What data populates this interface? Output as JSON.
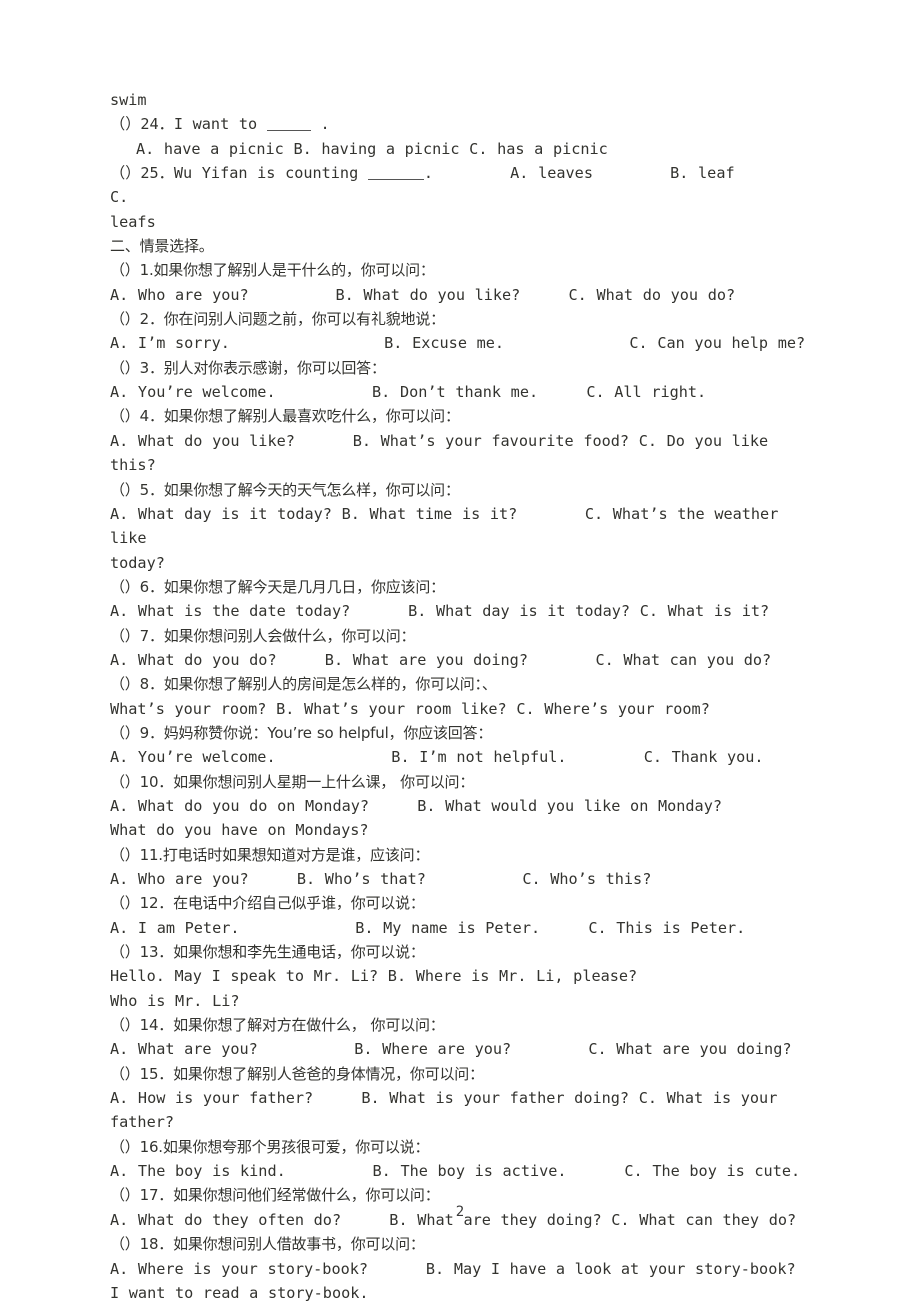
{
  "document": {
    "page_number": "2",
    "lines": [
      {
        "id": "l01",
        "text": "swim",
        "style": "en"
      },
      {
        "id": "l02",
        "text": "（）24．I want to ____ .",
        "style": "mixed",
        "blank": "w1",
        "pre": "（）24．I want to ",
        "post": " ."
      },
      {
        "id": "l03",
        "text": "A. have a picnic B. having a picnic C. has a picnic",
        "style": "en",
        "indent": true
      },
      {
        "id": "l04",
        "text": "（）25．Wu Yifan is counting _____.        A. leaves        B. leaf                 C.",
        "style": "mixed",
        "pre": "（）25．Wu Yifan is counting ",
        "post": ".        A. leaves        B. leaf                 C."
      },
      {
        "id": "l05",
        "text": "leafs",
        "style": "en"
      },
      {
        "id": "l06",
        "text": "二、情景选择。",
        "style": "cn"
      },
      {
        "id": "l07",
        "text": "（）1.如果你想了解别人是干什么的，你可以问：",
        "style": "cn"
      },
      {
        "id": "l08",
        "text": "A. Who are you?         B. What do you like?     C. What do you do?",
        "style": "en"
      },
      {
        "id": "l09",
        "text": "（）2．你在问别人问题之前，你可以有礼貌地说：",
        "style": "cn"
      },
      {
        "id": "l10",
        "text": "A. I’m sorry.                B. Excuse me.             C. Can you help me?",
        "style": "en"
      },
      {
        "id": "l11",
        "text": "（）3．别人对你表示感谢，你可以回答：",
        "style": "cn"
      },
      {
        "id": "l12",
        "text": "A. You’re welcome.          B. Don’t thank me.     C. All right.",
        "style": "en"
      },
      {
        "id": "l13",
        "text": "（）4．如果你想了解别人最喜欢吃什么，你可以问：",
        "style": "cn"
      },
      {
        "id": "l14",
        "text": "A. What do you like?      B. What’s your favourite food? C. Do you like this?",
        "style": "en"
      },
      {
        "id": "l15",
        "text": "（）5．如果你想了解今天的天气怎么样，你可以问：",
        "style": "cn"
      },
      {
        "id": "l16",
        "text": "A. What day is it today? B. What time is it?       C. What’s the weather like",
        "style": "en"
      },
      {
        "id": "l17",
        "text": "today?",
        "style": "en"
      },
      {
        "id": "l18",
        "text": "（）6．如果你想了解今天是几月几日，你应该问：",
        "style": "cn"
      },
      {
        "id": "l19",
        "text": "A. What is the date today?      B. What day is it today? C. What is it?",
        "style": "en"
      },
      {
        "id": "l20",
        "text": "（）7．如果你想问别人会做什么，你可以问：",
        "style": "cn"
      },
      {
        "id": "l21",
        "text": "A. What do you do?     B. What are you doing?       C. What can you do?",
        "style": "en"
      },
      {
        "id": "l22",
        "text": "（）8．如果你想了解别人的房间是怎么样的，你可以问：、",
        "style": "cn"
      },
      {
        "id": "l23",
        "text": "What’s your room? B. What’s your room like? C. Where’s your room?",
        "style": "en"
      },
      {
        "id": "l24",
        "text": "（）9．妈妈称赞你说：You’re so helpful，你应该回答：",
        "style": "cn"
      },
      {
        "id": "l25",
        "text": "A. You’re welcome.            B. I’m not helpful.        C. Thank you.",
        "style": "en"
      },
      {
        "id": "l26",
        "text": "（）10．如果你想问别人星期一上什么课， 你可以问：",
        "style": "cn"
      },
      {
        "id": "l27",
        "text": "A. What do you do on Monday?     B. What would you like on Monday?",
        "style": "en"
      },
      {
        "id": "l28",
        "text": "What do you have on Mondays?",
        "style": "en"
      },
      {
        "id": "l29",
        "text": "（）11.打电话时如果想知道对方是谁，应该问：",
        "style": "cn"
      },
      {
        "id": "l30",
        "text": "A. Who are you?     B. Who’s that?          C. Who’s this?",
        "style": "en"
      },
      {
        "id": "l31",
        "text": "（）12．在电话中介绍自己似乎谁，你可以说：",
        "style": "cn"
      },
      {
        "id": "l32",
        "text": "A. I am Peter.            B. My name is Peter.     C. This is Peter.",
        "style": "en"
      },
      {
        "id": "l33",
        "text": "（）13．如果你想和李先生通电话，你可以说：",
        "style": "cn"
      },
      {
        "id": "l34",
        "text": "Hello. May I speak to Mr. Li? B. Where is Mr. Li, please?",
        "style": "en"
      },
      {
        "id": "l35",
        "text": "Who is Mr. Li?",
        "style": "en"
      },
      {
        "id": "l36",
        "text": "（）14．如果你想了解对方在做什么， 你可以问：",
        "style": "cn"
      },
      {
        "id": "l37",
        "text": "A. What are you?          B. Where are you?        C. What are you doing?",
        "style": "en"
      },
      {
        "id": "l38",
        "text": "（）15．如果你想了解别人爸爸的身体情况，你可以问：",
        "style": "cn"
      },
      {
        "id": "l39",
        "text": "A. How is your father?     B. What is your father doing? C. What is your father?",
        "style": "en"
      },
      {
        "id": "l40",
        "text": "（）16.如果你想夸那个男孩很可爱，你可以说：",
        "style": "cn"
      },
      {
        "id": "l41",
        "text": "A. The boy is kind.         B. The boy is active.      C. The boy is cute.",
        "style": "en"
      },
      {
        "id": "l42",
        "text": "（）17．如果你想问他们经常做什么，你可以问：",
        "style": "cn"
      },
      {
        "id": "l43",
        "text": "A. What do they often do?     B. What are they doing? C. What can they do?",
        "style": "en"
      },
      {
        "id": "l44",
        "text": "（）18．如果你想问别人借故事书，你可以问：",
        "style": "cn"
      },
      {
        "id": "l45",
        "text": "A. Where is your story-book?      B. May I have a look at your story-book?",
        "style": "en"
      },
      {
        "id": "l46",
        "text": "I want to read a story-book.",
        "style": "en"
      }
    ]
  }
}
